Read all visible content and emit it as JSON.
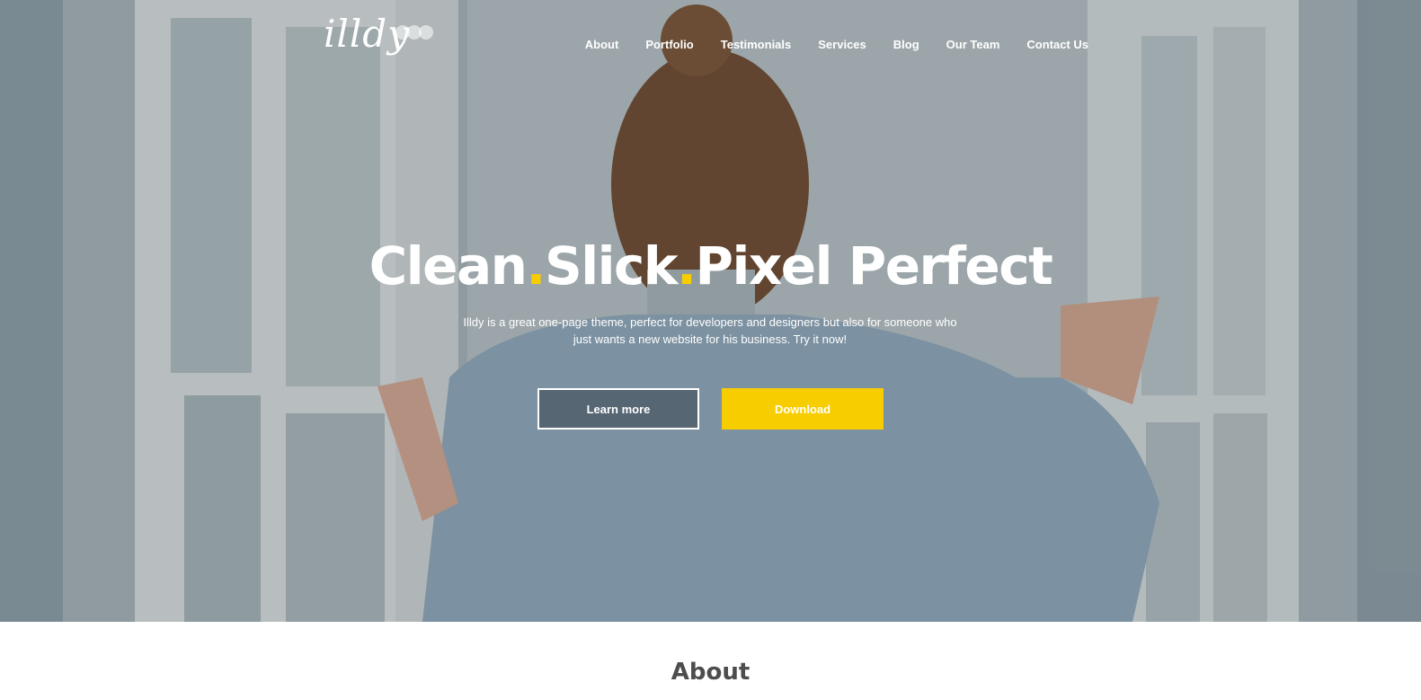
{
  "brand": {
    "logo_text": "illdy",
    "accent_color": "#f8cd00"
  },
  "nav": {
    "items": [
      {
        "label": "About"
      },
      {
        "label": "Portfolio"
      },
      {
        "label": "Testimonials"
      },
      {
        "label": "Services"
      },
      {
        "label": "Blog"
      },
      {
        "label": "Our Team"
      },
      {
        "label": "Contact Us"
      }
    ]
  },
  "hero": {
    "headline": {
      "word1": "Clean",
      "sep1": ".",
      "word2": "Slick",
      "sep2": ".",
      "word3": "Pixel Perfect"
    },
    "subtitle": "Illdy is a great one-page theme, perfect for developers and designers but also for someone who just wants a new website for his business. Try it now!",
    "buttons": {
      "learn_more": "Learn more",
      "download": "Download"
    },
    "background_image": "woman-at-window-photo"
  },
  "about": {
    "title": "About"
  }
}
